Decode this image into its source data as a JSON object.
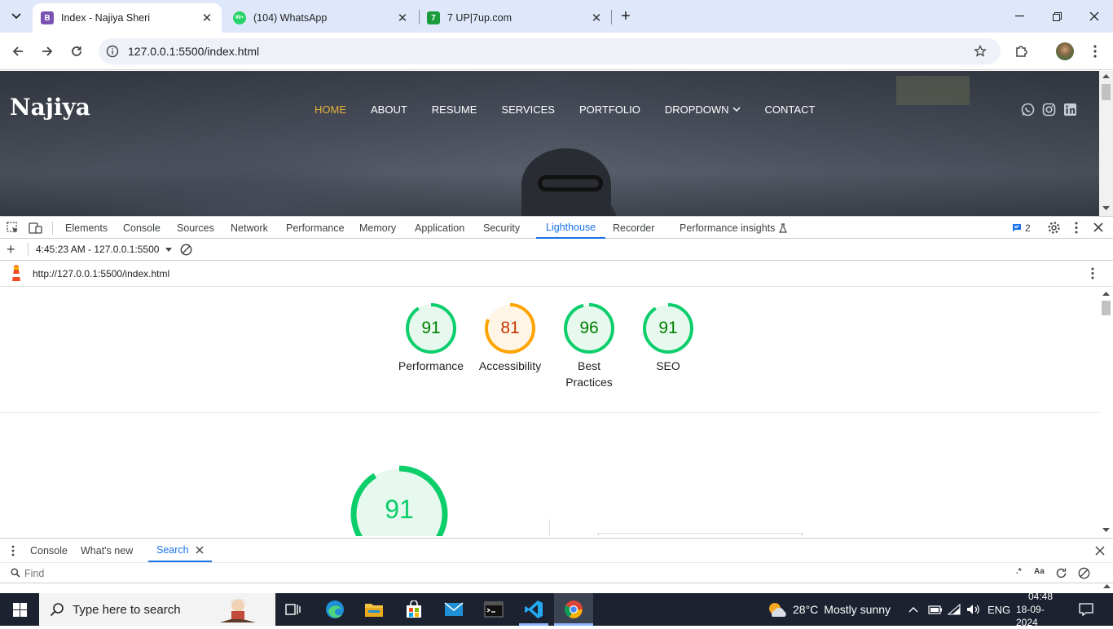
{
  "browser": {
    "tabs": [
      {
        "title": "Index - Najiya Sheri",
        "favicon": "B",
        "favicon_color": "#7952b3",
        "active": true
      },
      {
        "title": "(104) WhatsApp",
        "favicon": "99+",
        "favicon_color": "#25d366",
        "active": false
      },
      {
        "title": "7 UP|7up.com",
        "favicon": "7",
        "favicon_color": "#1a9c3c",
        "active": false
      }
    ],
    "address": "127.0.0.1:5500/index.html"
  },
  "site": {
    "logo": "Najiya",
    "nav": [
      "HOME",
      "ABOUT",
      "RESUME",
      "SERVICES",
      "PORTFOLIO",
      "DROPDOWN",
      "CONTACT"
    ],
    "active_nav": "HOME",
    "accent": "#e8b23a",
    "social": [
      "whatsapp-icon",
      "instagram-icon",
      "linkedin-icon"
    ]
  },
  "devtools": {
    "tabs": [
      "Elements",
      "Console",
      "Sources",
      "Network",
      "Performance",
      "Memory",
      "Application",
      "Security",
      "Lighthouse",
      "Recorder",
      "Performance insights"
    ],
    "active_tab": "Lighthouse",
    "issues_count": "2",
    "report_selector": "4:45:23 AM - 127.0.0.1:5500",
    "report_url": "http://127.0.0.1:5500/index.html",
    "scores": [
      {
        "value": "91",
        "label": "Performance",
        "color": "#0cce6b",
        "text_color": "#008000",
        "fill": "#e7f8ee"
      },
      {
        "value": "81",
        "label": "Accessibility",
        "color": "#ffa400",
        "text_color": "#c33300",
        "fill": "#fff5e6"
      },
      {
        "value": "96",
        "label": "Best\nPractices",
        "color": "#0cce6b",
        "text_color": "#008000",
        "fill": "#e7f8ee"
      },
      {
        "value": "91",
        "label": "SEO",
        "color": "#0cce6b",
        "text_color": "#008000",
        "fill": "#e7f8ee"
      }
    ],
    "big_score": "91",
    "drawer_tabs": [
      "Console",
      "What's new",
      "Search"
    ],
    "active_drawer": "Search",
    "find_placeholder": "Find",
    "find_options": [
      ".*",
      "Aa"
    ]
  },
  "taskbar": {
    "search_placeholder": "Type here to search",
    "weather_temp": "28°C",
    "weather_desc": "Mostly sunny",
    "language": "ENG",
    "time": "04:48",
    "date": "18-09-2024"
  }
}
